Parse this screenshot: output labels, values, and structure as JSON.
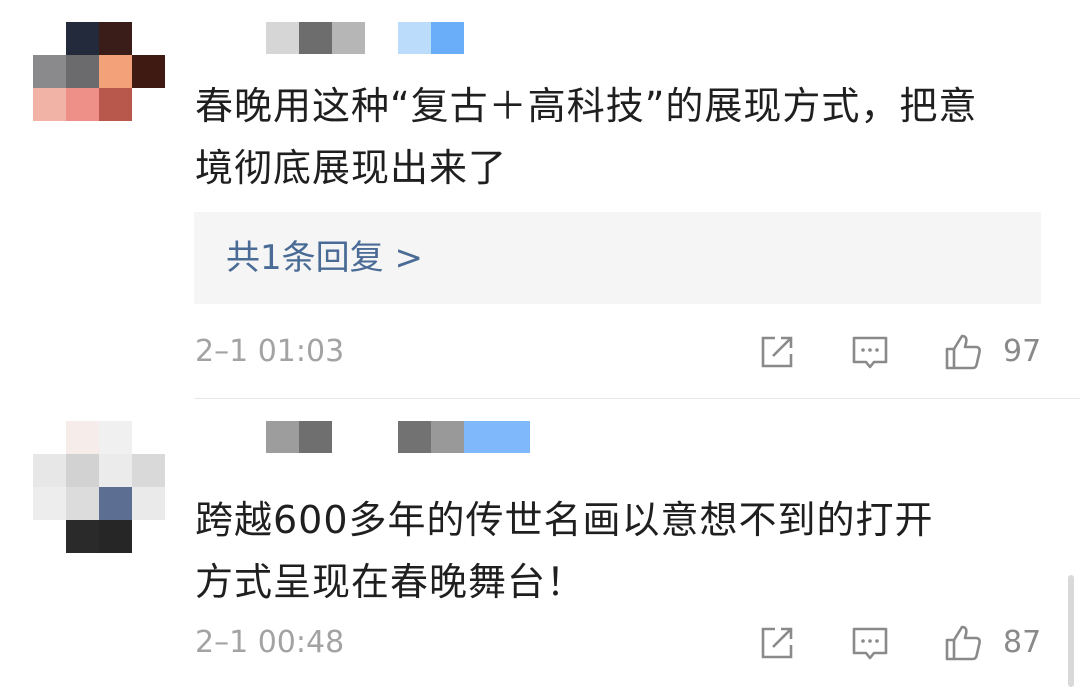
{
  "comments": [
    {
      "text_line1": "春晚用这种“复古＋高科技”的展现方式，把意",
      "text_line2": "境彻底展现出来了",
      "reply_link": "共1条回复 >",
      "time": "2–1 01:03",
      "likes": "97"
    },
    {
      "text_line1": "跨越600多年的传世名画以意想不到的打开",
      "text_line2": "方式呈现在春晚舞台！",
      "time": "2–1 00:48",
      "likes": "87"
    }
  ],
  "icons": {
    "share": "share-icon",
    "comment": "comment-icon",
    "like": "thumbs-up-icon"
  },
  "colors": {
    "reply_link": "#4a6b95",
    "meta_text": "#a3a3a3",
    "icon": "#8a8a8a",
    "reply_bg": "#f5f5f5"
  }
}
